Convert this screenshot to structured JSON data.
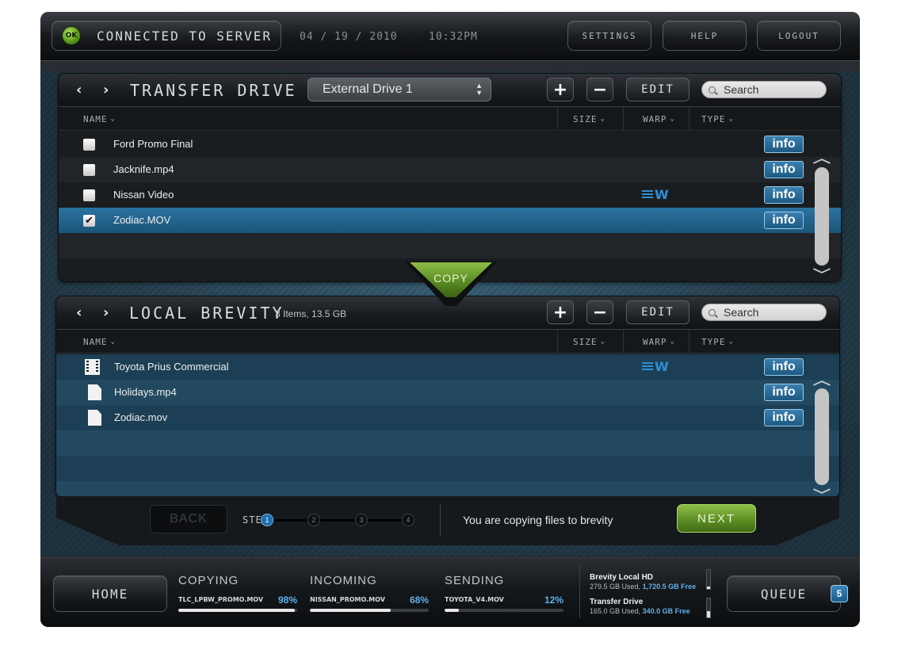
{
  "topbar": {
    "connection_status": "CONNECTED TO SERVER",
    "ok_label": "OK",
    "date": "04 / 19 / 2010",
    "time": "10:32PM",
    "settings_label": "SETTINGS",
    "help_label": "HELP",
    "logout_label": "LOGOUT"
  },
  "transfer_panel": {
    "back_icon": "‹",
    "forward_icon": "›",
    "title": "TRANSFER DRIVE",
    "drive_select": "External Drive 1",
    "add_label": "+",
    "remove_label": "−",
    "edit_label": "EDIT",
    "search_placeholder": "Search",
    "columns": {
      "name": "NAME",
      "size": "SIZE",
      "warp": "WARP",
      "type": "TYPE"
    },
    "rows": [
      {
        "name": "Ford Promo Final",
        "checked": false,
        "warp": "",
        "info": "info",
        "selected": false
      },
      {
        "name": "Jacknife.mp4",
        "checked": false,
        "warp": "",
        "info": "info",
        "selected": false
      },
      {
        "name": "Nissan Video",
        "checked": false,
        "warp": "W",
        "info": "info",
        "selected": false
      },
      {
        "name": "Zodiac.MOV",
        "checked": true,
        "warp": "",
        "info": "info",
        "selected": true
      }
    ]
  },
  "copy_tab": {
    "label": "COPY"
  },
  "local_panel": {
    "back_icon": "‹",
    "forward_icon": "›",
    "title": "LOCAL BREVITY",
    "summary": "3 Items, 13.5 GB",
    "add_label": "+",
    "remove_label": "−",
    "edit_label": "EDIT",
    "search_placeholder": "Search",
    "columns": {
      "name": "NAME",
      "size": "SIZE",
      "warp": "WARP",
      "type": "TYPE"
    },
    "rows": [
      {
        "name": "Toyota Prius Commercial",
        "icon": "film-icon",
        "warp": "W",
        "info": "info"
      },
      {
        "name": "Holidays.mp4",
        "icon": "file-icon",
        "warp": "",
        "info": "info"
      },
      {
        "name": "Zodiac.mov",
        "icon": "file-icon",
        "warp": "",
        "info": "info"
      }
    ]
  },
  "wizard": {
    "back_label": "BACK",
    "step_label": "STEP",
    "steps": [
      "1",
      "2",
      "3",
      "4"
    ],
    "current_step": 1,
    "message": "You are copying files to brevity",
    "next_label": "NEXT"
  },
  "bottombar": {
    "home_label": "HOME",
    "queue_label": "QUEUE",
    "queue_count": "5",
    "transfers": [
      {
        "title": "COPYING",
        "file": "TLC_LPBW_PROMO.MOV",
        "percent_label": "98%",
        "progress": 0.98
      },
      {
        "title": "INCOMING",
        "file": "NISSAN_PROMO.MOV",
        "percent_label": "68%",
        "progress": 0.68
      },
      {
        "title": "SENDING",
        "file": "TOYOTA_V4.MOV",
        "percent_label": "12%",
        "progress": 0.12
      }
    ],
    "storage": [
      {
        "name": "Brevity Local HD",
        "used": "279.5 GB Used",
        "free": "1,720.5 GB Free",
        "fill": 0.14
      },
      {
        "name": "Transfer Drive",
        "used": "165.0 GB Used",
        "free": "340.0 GB Free",
        "fill": 0.33
      }
    ]
  },
  "colors": {
    "accent_blue": "#1d6fae",
    "selected_row": "#1f5f87",
    "go_green": "#5e8f24",
    "info_blue": "#2a6f9e"
  }
}
